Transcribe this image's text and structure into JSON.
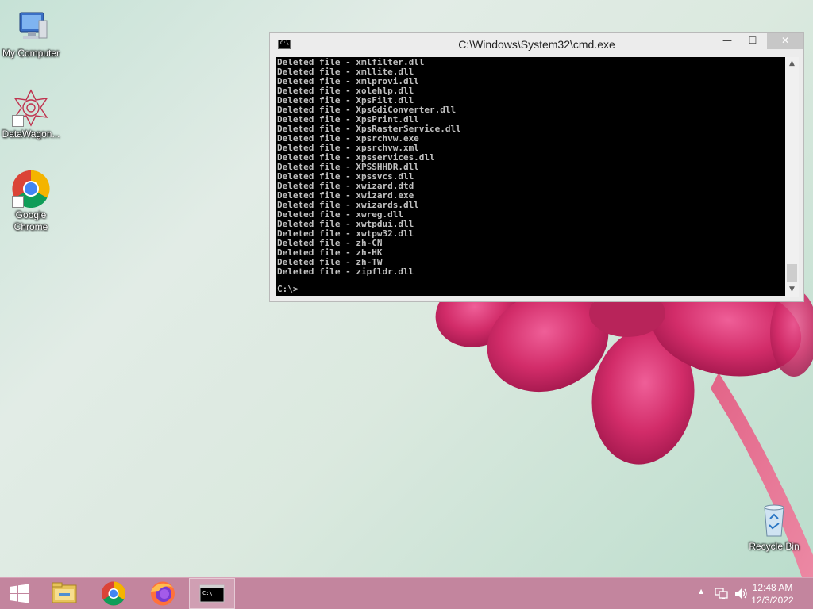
{
  "desktop": {
    "icons": [
      {
        "label": "My Computer",
        "icon": "computer-icon"
      },
      {
        "label": "DataWagon...",
        "icon": "datawagon-icon"
      },
      {
        "label": "Google Chrome",
        "icon": "chrome-icon"
      },
      {
        "label": "Recycle Bin",
        "icon": "recycle-bin-icon"
      }
    ]
  },
  "cmd": {
    "title": "C:\\Windows\\System32\\cmd.exe",
    "icon_text": "C:\\",
    "lines": [
      "Deleted file - xmlfilter.dll",
      "Deleted file - xmllite.dll",
      "Deleted file - xmlprovi.dll",
      "Deleted file - xolehlp.dll",
      "Deleted file - XpsFilt.dll",
      "Deleted file - XpsGdiConverter.dll",
      "Deleted file - XpsPrint.dll",
      "Deleted file - XpsRasterService.dll",
      "Deleted file - xpsrchvw.exe",
      "Deleted file - xpsrchvw.xml",
      "Deleted file - xpsservices.dll",
      "Deleted file - XPSSHHDR.dll",
      "Deleted file - xpssvcs.dll",
      "Deleted file - xwizard.dtd",
      "Deleted file - xwizard.exe",
      "Deleted file - xwizards.dll",
      "Deleted file - xwreg.dll",
      "Deleted file - xwtpdui.dll",
      "Deleted file - xwtpw32.dll",
      "Deleted file - zh-CN",
      "Deleted file - zh-HK",
      "Deleted file - zh-TW",
      "Deleted file - zipfldr.dll"
    ],
    "prompt": "C:\\>",
    "buttons": {
      "minimize": "—",
      "maximize": "☐",
      "close": "✕"
    },
    "scroll_up": "▲",
    "scroll_down": "▼"
  },
  "taskbar": {
    "start_icon": "windows-start-icon",
    "pinned": [
      "file-explorer-icon",
      "chrome-icon",
      "firefox-icon",
      "cmd-icon"
    ],
    "cmd_icon_text": "C:\\",
    "tray": {
      "chevron": "▲",
      "time": "12:48 AM",
      "date": "12/3/2022"
    }
  },
  "colors": {
    "taskbar": "#c3859e",
    "flower": "#d8336f",
    "console_bg": "#000000",
    "console_fg": "#c0c0c0"
  }
}
